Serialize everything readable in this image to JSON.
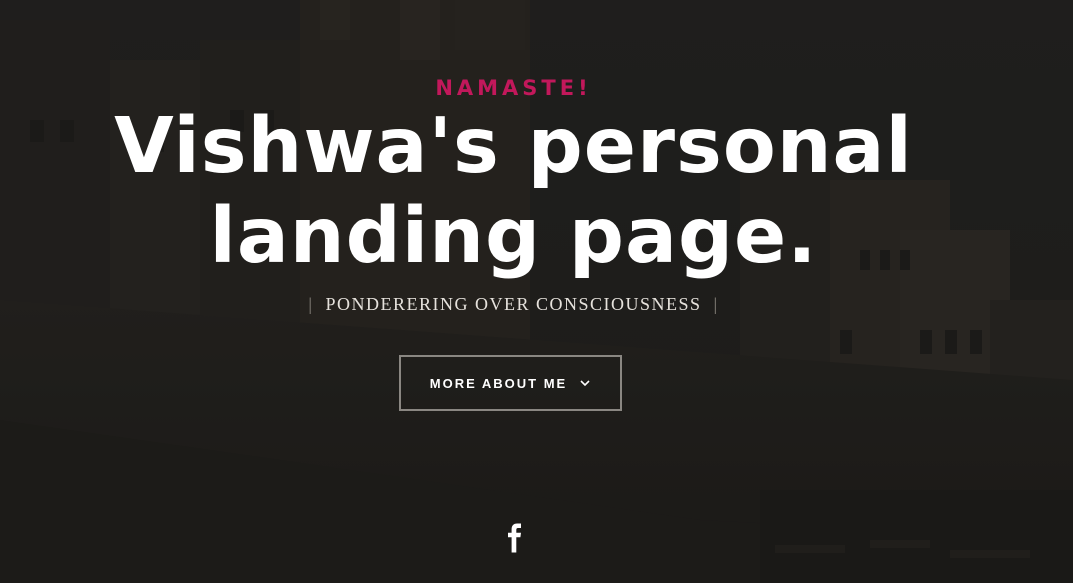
{
  "hero": {
    "kicker": "NAMASTE!",
    "headline_line1": "Vishwa's personal",
    "headline_line2": "landing page.",
    "tagline": "PONDERERING OVER CONSCIOUSNESS",
    "cta_label": "MORE ABOUT ME",
    "cta_icon": "chevron-down-icon"
  },
  "social": {
    "icon": "facebook-icon"
  },
  "colors": {
    "accent": "#c2185b",
    "headline": "#ffffff",
    "overlay": "#1f1e1c"
  }
}
